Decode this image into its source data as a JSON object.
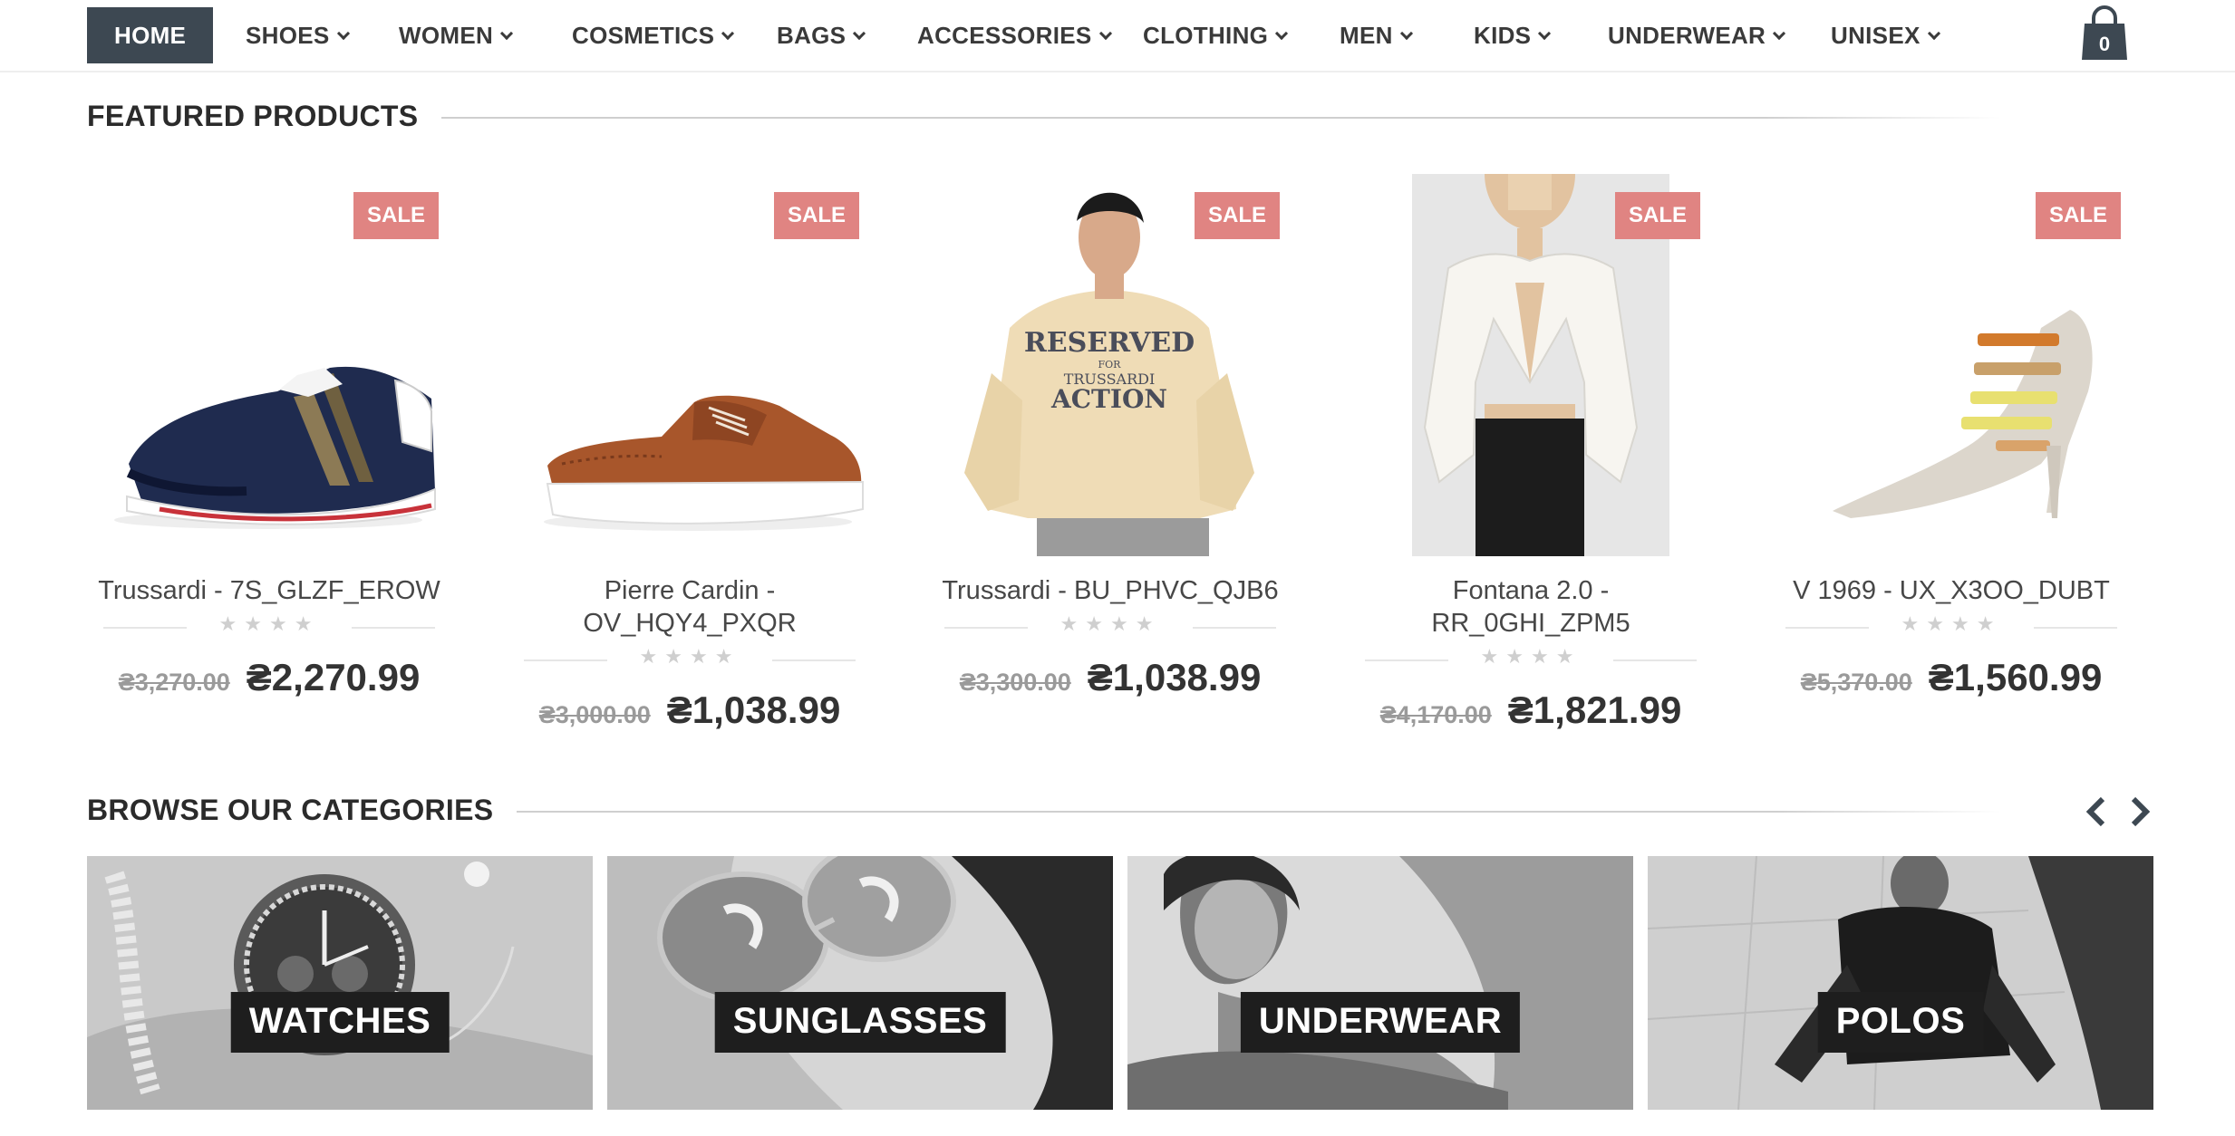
{
  "nav": {
    "items": [
      {
        "label": "HOME",
        "active": true
      },
      {
        "label": "SHOES"
      },
      {
        "label": "WOMEN"
      },
      {
        "label": "COSMETICS"
      },
      {
        "label": "BAGS"
      },
      {
        "label": "ACCESSORIES"
      },
      {
        "label": "CLOTHING"
      },
      {
        "label": "MEN"
      },
      {
        "label": "KIDS"
      },
      {
        "label": "UNDERWEAR"
      },
      {
        "label": "UNISEX"
      }
    ],
    "cart_count": "0"
  },
  "featured": {
    "title": "FEATURED PRODUCTS",
    "products": [
      {
        "name": "Trussardi - 7S_GLZF_EROW",
        "badge": "SALE",
        "old_price": "₴3,270.00",
        "price": "₴2,270.99",
        "rating": 0,
        "image": "sneaker"
      },
      {
        "name": "Pierre Cardin - OV_HQY4_PXQR",
        "badge": "SALE",
        "old_price": "₴3,000.00",
        "price": "₴1,038.99",
        "rating": 0,
        "image": "brogue"
      },
      {
        "name": "Trussardi - BU_PHVC_QJB6",
        "badge": "SALE",
        "old_price": "₴3,300.00",
        "price": "₴1,038.99",
        "rating": 0,
        "image": "hoodie"
      },
      {
        "name": "Fontana 2.0 - RR_0GHI_ZPM5",
        "badge": "SALE",
        "old_price": "₴4,170.00",
        "price": "₴1,821.99",
        "rating": 0,
        "image": "blazer"
      },
      {
        "name": "V 1969 - UX_X3OO_DUBT",
        "badge": "SALE",
        "old_price": "₴5,370.00",
        "price": "₴1,560.99",
        "rating": 0,
        "image": "heels"
      }
    ]
  },
  "categories": {
    "title": "BROWSE OUR CATEGORIES",
    "items": [
      {
        "label": "WATCHES"
      },
      {
        "label": "SUNGLASSES"
      },
      {
        "label": "UNDERWEAR"
      },
      {
        "label": "POLOS"
      }
    ]
  },
  "colors": {
    "nav_active_bg": "#3d4852",
    "sale_badge": "#e08482",
    "category_label_bg": "#1e1e1e"
  }
}
